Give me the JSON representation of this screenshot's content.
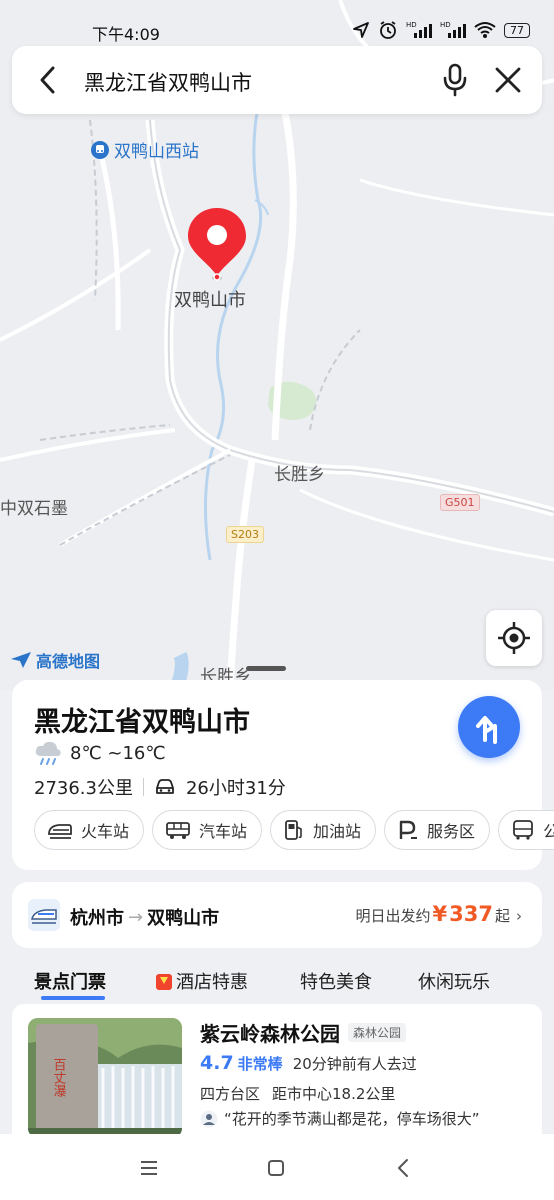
{
  "status_bar": {
    "time": "下午4:09",
    "battery": "77"
  },
  "search": {
    "query": "黑龙江省双鸭山市"
  },
  "map": {
    "station_label": "双鸭山西站",
    "pin_label": "双鸭山市",
    "town_label_1": "长胜乡",
    "town_label_2": "中双石墨",
    "town_label_3": "长胜乡",
    "road_g": "G501",
    "road_s": "S203",
    "brand": "高德地图"
  },
  "card": {
    "city": "黑龙江省双鸭山市",
    "weather": "8℃ ~16℃",
    "distance": "2736.3公里",
    "drive_time": "26小时31分",
    "categories": [
      {
        "label": "火车站",
        "icon": "train-icon"
      },
      {
        "label": "汽车站",
        "icon": "bus-icon"
      },
      {
        "label": "加油站",
        "icon": "gas-station-icon"
      },
      {
        "label": "服务区",
        "icon": "service-area-icon"
      },
      {
        "label": "公",
        "icon": "bus-stop-icon"
      }
    ]
  },
  "route": {
    "from": "杭州市",
    "to": "双鸭山市",
    "price_prefix": "明日出发约",
    "currency": "¥",
    "price": "337",
    "price_suffix": "起"
  },
  "tabs": [
    "景点门票",
    "酒店特惠",
    "特色美食",
    "休闲玩乐"
  ],
  "poi": {
    "name": "紫云岭森林公园",
    "tag": "森林公园",
    "score": "4.7",
    "level": "非常棒",
    "recent": "20分钟前有人去过",
    "district": "四方台区",
    "distance": "距市中心18.2公里",
    "review": "“花开的季节满山都是花，停车场很大”",
    "thumb_text": "百丈瀑"
  }
}
